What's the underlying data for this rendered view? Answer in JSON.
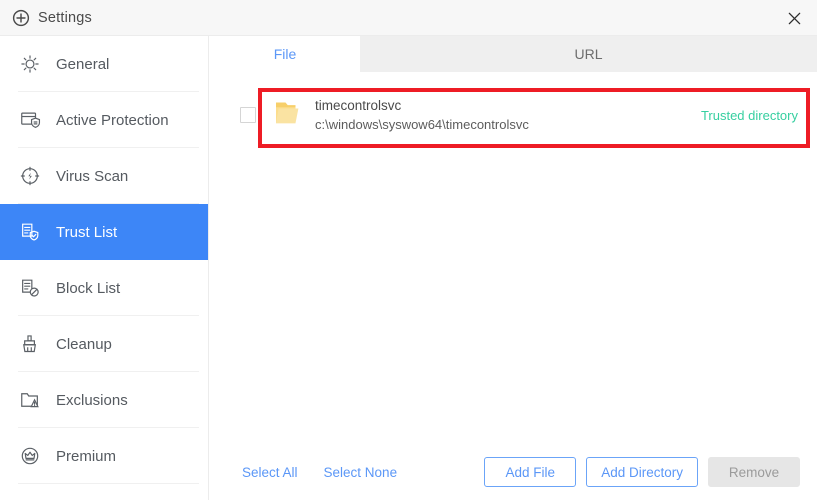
{
  "window": {
    "title": "Settings",
    "app_icon": "plus-circle-icon",
    "close_icon": "close-icon"
  },
  "sidebar": {
    "items": [
      {
        "label": "General",
        "icon": "gear-outline-icon",
        "active": false
      },
      {
        "label": "Active Protection",
        "icon": "shield-window-icon",
        "active": false
      },
      {
        "label": "Virus Scan",
        "icon": "crosshair-bolt-icon",
        "active": false
      },
      {
        "label": "Trust List",
        "icon": "document-check-icon",
        "active": true
      },
      {
        "label": "Block List",
        "icon": "document-block-icon",
        "active": false
      },
      {
        "label": "Cleanup",
        "icon": "broom-icon",
        "active": false
      },
      {
        "label": "Exclusions",
        "icon": "folder-warning-icon",
        "active": false
      },
      {
        "label": "Premium",
        "icon": "crown-circle-icon",
        "active": false
      }
    ]
  },
  "main": {
    "tabs": [
      {
        "label": "File",
        "active": true
      },
      {
        "label": "URL",
        "active": false
      }
    ],
    "list": {
      "rows": [
        {
          "checked": false,
          "icon": "folder-icon",
          "name": "timecontrolsvc",
          "path": "c:\\windows\\syswow64\\timecontrolsvc",
          "status": "Trusted directory"
        }
      ]
    },
    "footer": {
      "select_all": "Select All",
      "select_none": "Select None",
      "add_file": "Add File",
      "add_directory": "Add Directory",
      "remove": "Remove"
    }
  },
  "annotation": {
    "highlight_color": "#ee1c25"
  },
  "colors": {
    "accent_blue": "#3d86f7",
    "link_blue": "#5b97f7",
    "status_green": "#36cfa0",
    "titlebar_bg": "#f7f7f7",
    "inactive_tab_bg": "#efefef",
    "disabled_bg": "#e6e6e6"
  }
}
